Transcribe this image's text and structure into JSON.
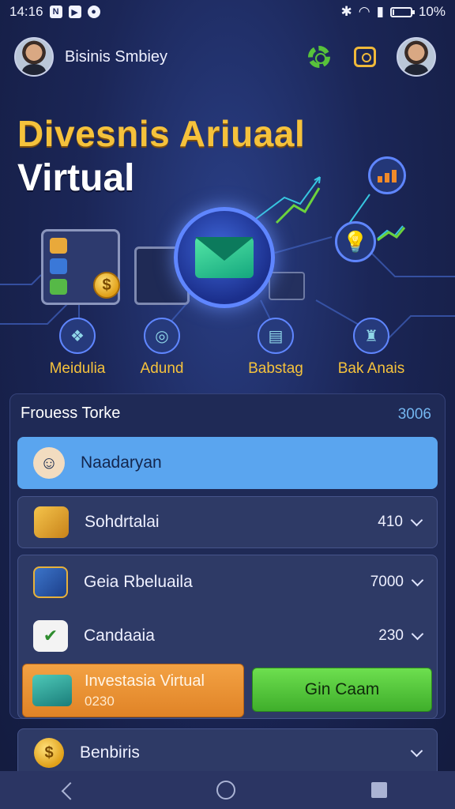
{
  "status_bar": {
    "time": "14:16",
    "battery": "10%",
    "notification_icons": [
      "n-icon",
      "play-icon",
      "location-icon"
    ]
  },
  "header": {
    "app_name": "Bisinis Smbiey"
  },
  "hero": {
    "title": "Divesnis Ariuaal",
    "subtitle": "Virtual"
  },
  "features": [
    {
      "label": "Meidulia",
      "icon": "brain-icon"
    },
    {
      "label": "Adund",
      "icon": "chat-icon"
    },
    {
      "label": "Babstag",
      "icon": "document-icon"
    },
    {
      "label": "Bak Anais",
      "icon": "robot-icon"
    }
  ],
  "panel": {
    "title": "Frouess Torke",
    "count": "3006",
    "items": [
      {
        "label": "Naadaryan",
        "value": ""
      },
      {
        "label": "Sohdrtalai",
        "value": "410"
      },
      {
        "label": "Geia Rbeluaila",
        "value": "7000"
      },
      {
        "label": "Candaaia",
        "value": "230"
      }
    ],
    "invest_button": {
      "title": "Investasia Virtual",
      "sub": "0230"
    },
    "gain_button": "Gin Caam",
    "bottom_item": {
      "label": "Benbiris"
    }
  },
  "colors": {
    "accent_gold": "#f5c23c",
    "highlight_blue": "#5aa5ef",
    "button_green": "#4fc333",
    "button_orange": "#ea8f30"
  }
}
